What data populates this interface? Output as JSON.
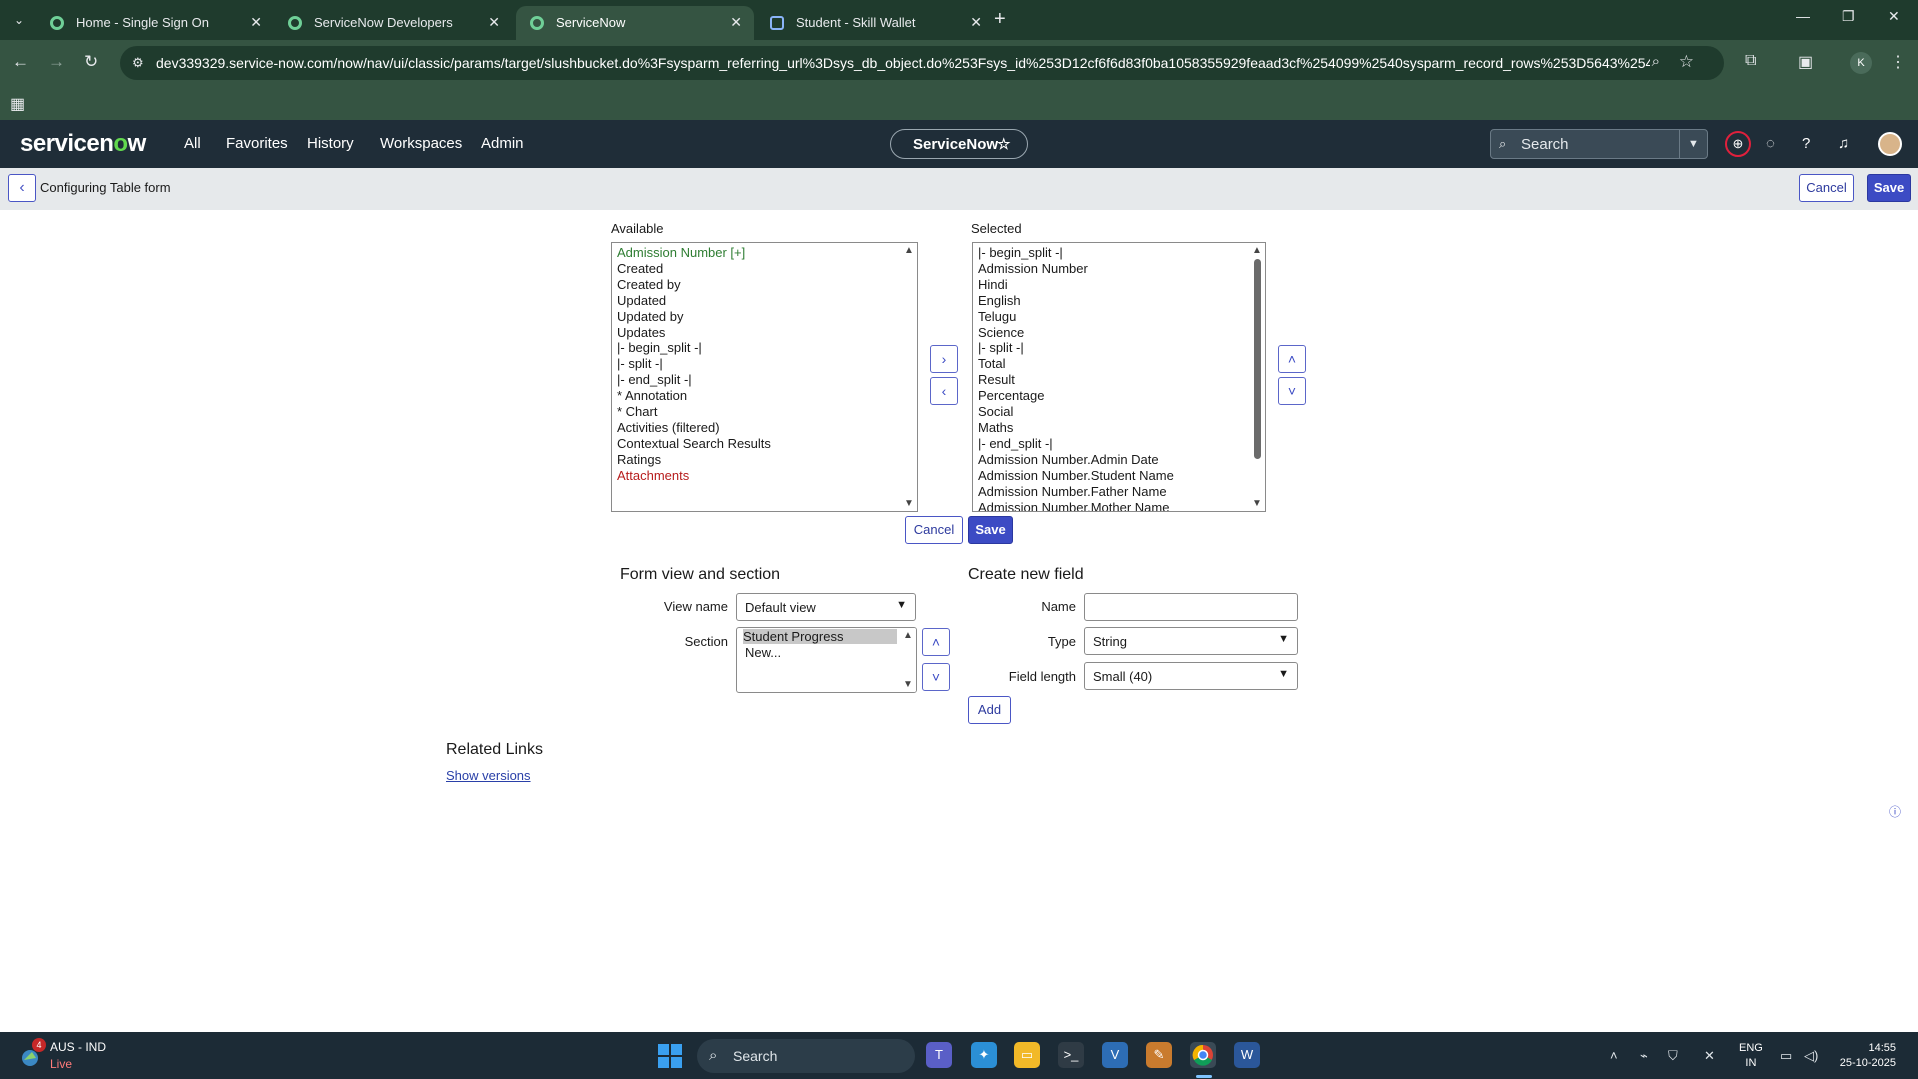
{
  "browser": {
    "tabs": [
      {
        "title": "Home - Single Sign On",
        "active": false
      },
      {
        "title": "ServiceNow Developers",
        "active": false
      },
      {
        "title": "ServiceNow",
        "active": true
      },
      {
        "title": "Student - Skill Wallet",
        "active": false
      }
    ],
    "url": "dev339329.service-now.com/now/nav/ui/classic/params/target/slushbucket.do%3Fsysparm_referring_url%3Dsys_db_object.do%253Fsys_id%253D12cf6f6d83f0ba1058355929feaad3cf%254099%2540sysparm_record_rows%253D5643%254099...",
    "profile_initial": "K"
  },
  "sn_header": {
    "logo_prefix": "servicen",
    "logo_o": "o",
    "logo_suffix": "w",
    "nav": [
      "All",
      "Favorites",
      "History",
      "Workspaces",
      "Admin"
    ],
    "app_name": "ServiceNow",
    "search_label": "Search"
  },
  "context_bar": {
    "title": "Configuring Table form",
    "cancel": "Cancel",
    "save": "Save"
  },
  "slushbucket": {
    "available_label": "Available",
    "selected_label": "Selected",
    "available": [
      "Admission Number [+]",
      "Created",
      "Created by",
      "Updated",
      "Updated by",
      "Updates",
      "|- begin_split -|",
      "|- split -|",
      "|- end_split -|",
      "* Annotation",
      "* Chart",
      "Activities (filtered)",
      "Contextual Search Results",
      "Ratings",
      "Attachments"
    ],
    "selected": [
      "|- begin_split -|",
      "Admission Number",
      "Hindi",
      "English",
      "Telugu",
      "Science",
      "|- split -|",
      "Total",
      "Result",
      "Percentage",
      "Social",
      "Maths",
      "|- end_split -|",
      "Admission Number.Admin Date",
      "Admission Number.Student Name",
      "Admission Number.Father Name",
      "Admission Number.Mother Name"
    ],
    "cancel": "Cancel",
    "save": "Save"
  },
  "form_view": {
    "heading": "Form view and section",
    "view_name_label": "View name",
    "view_name_value": "Default view",
    "section_label": "Section",
    "sections": [
      "Student Progress",
      "New..."
    ]
  },
  "new_field": {
    "heading": "Create new field",
    "name_label": "Name",
    "name_value": "",
    "type_label": "Type",
    "type_value": "String",
    "length_label": "Field length",
    "length_value": "Small (40)",
    "add": "Add"
  },
  "related_links": {
    "heading": "Related Links",
    "show_versions": "Show versions"
  },
  "taskbar": {
    "news_title": "AUS - IND",
    "news_sub": "Live",
    "badge": "4",
    "search": "Search",
    "lang_1": "ENG",
    "lang_2": "IN",
    "time": "14:55",
    "date": "25-10-2025"
  }
}
